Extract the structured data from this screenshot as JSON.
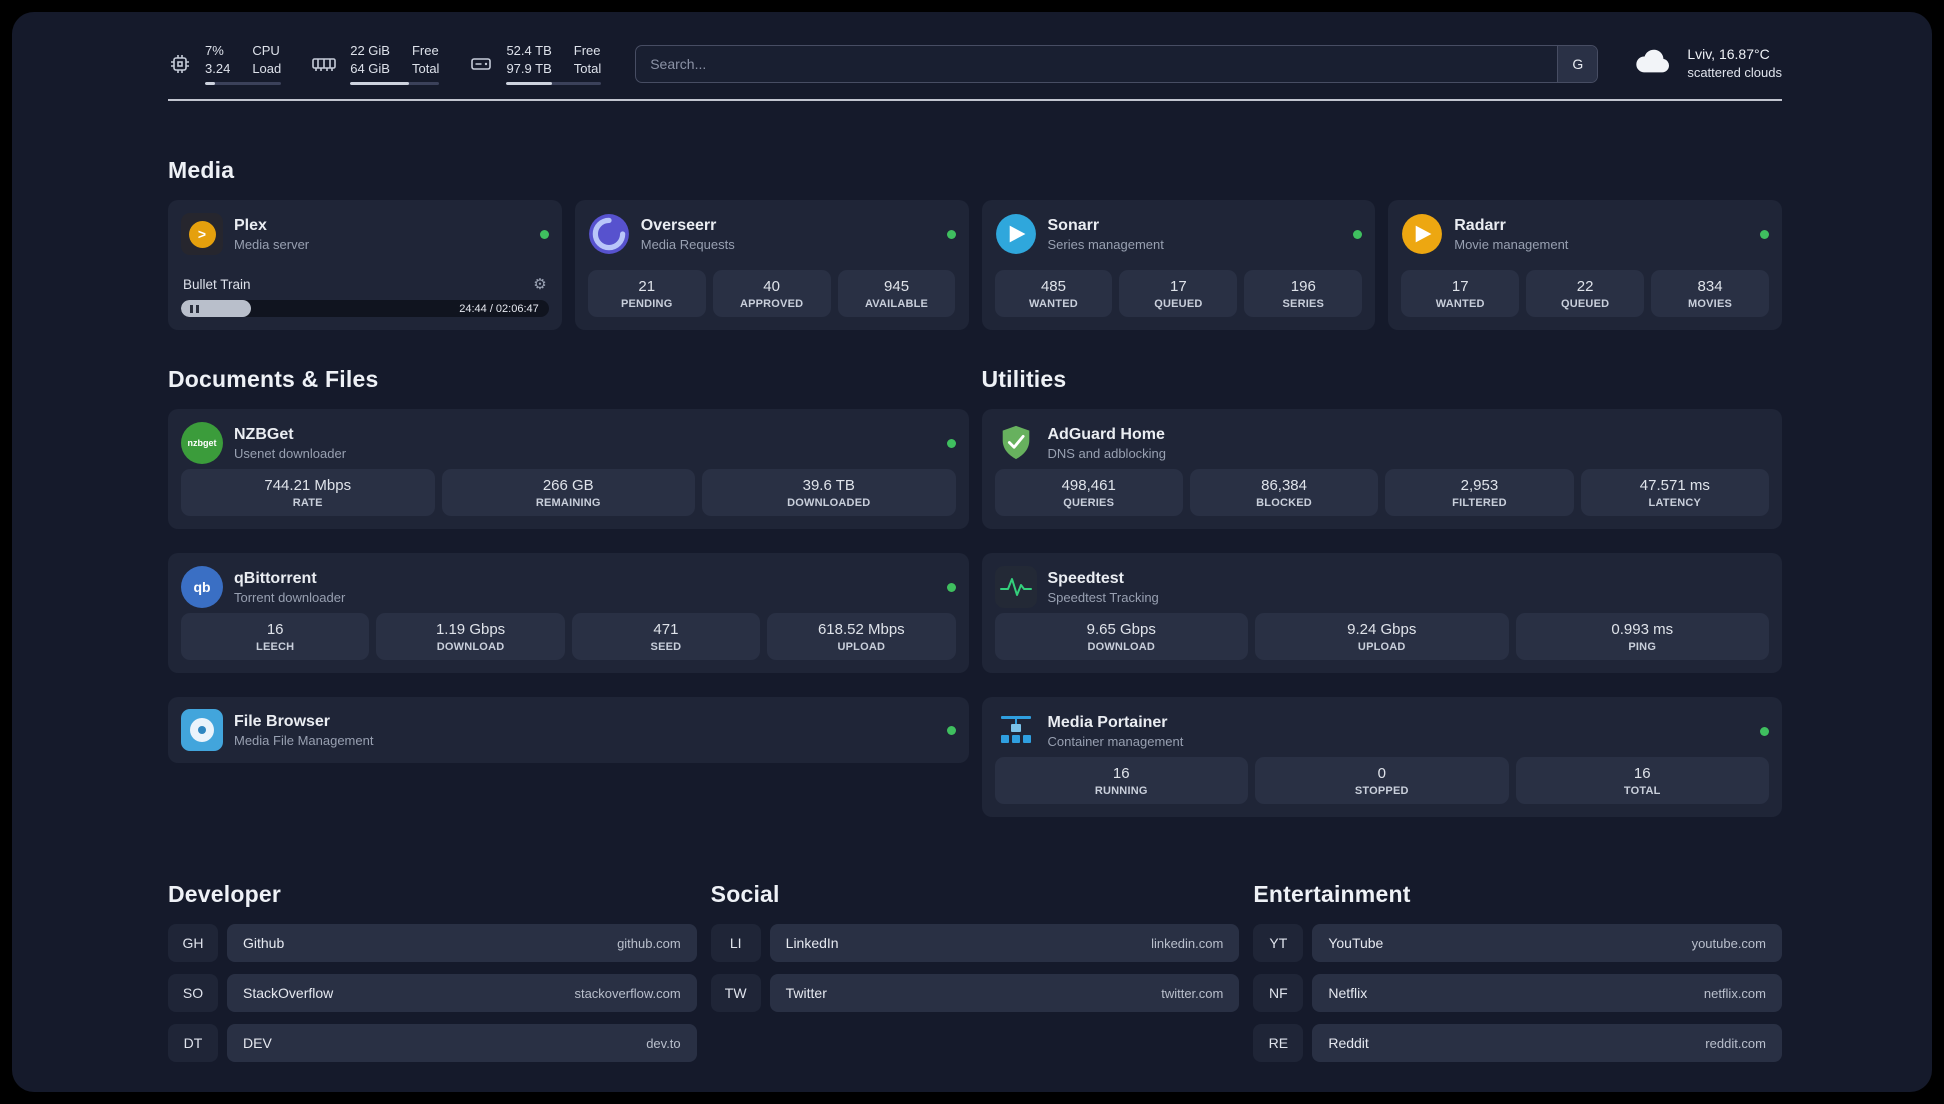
{
  "colors": {
    "page_background": "#151a2b",
    "card_background": "#1f2537",
    "tile_background": "#293044",
    "status_online": "#3fbf5f",
    "plex_accent": "#e5a00d",
    "overseerr_accent": "#5752ce",
    "sonarr_accent": "#2fa7dc",
    "radarr_accent": "#eda711",
    "nzbget_accent": "#3b9c3b",
    "qbittorrent_accent": "#3a6fc4",
    "filebrowser_accent": "#42a5dc",
    "adguard_accent": "#67b15e",
    "speedtest_accent": "#34d07c",
    "portainer_accent": "#2f9fe0"
  },
  "topbar": {
    "metrics": [
      {
        "icon": "cpu-icon",
        "value_top": "7%",
        "value_bottom": "3.24",
        "label_top": "CPU",
        "label_bottom": "Load",
        "progress": 13
      },
      {
        "icon": "memory-icon",
        "value_top": "22 GiB",
        "value_bottom": "64 GiB",
        "label_top": "Free",
        "label_bottom": "Total",
        "progress": 66
      },
      {
        "icon": "disk-icon",
        "value_top": "52.4 TB",
        "value_bottom": "97.9 TB",
        "label_top": "Free",
        "label_bottom": "Total",
        "progress": 48
      }
    ],
    "search": {
      "placeholder": "Search...",
      "engine_label": "G"
    },
    "weather": {
      "icon": "cloud-icon",
      "location": "Lviv, 16.87°C",
      "condition": "scattered clouds"
    }
  },
  "sections": {
    "media": {
      "title": "Media",
      "cards": [
        {
          "icon": "plex-icon",
          "name": "Plex",
          "subtitle": "Media server",
          "online": true,
          "player": {
            "title": "Bullet Train",
            "time": "24:44 / 02:06:47",
            "progress": 19,
            "state": "paused"
          }
        },
        {
          "icon": "overseerr-icon",
          "name": "Overseerr",
          "subtitle": "Media Requests",
          "online": true,
          "stats": [
            {
              "value": "21",
              "label": "PENDING"
            },
            {
              "value": "40",
              "label": "APPROVED"
            },
            {
              "value": "945",
              "label": "AVAILABLE"
            }
          ]
        },
        {
          "icon": "sonarr-icon",
          "name": "Sonarr",
          "subtitle": "Series management",
          "online": true,
          "stats": [
            {
              "value": "485",
              "label": "WANTED"
            },
            {
              "value": "17",
              "label": "QUEUED"
            },
            {
              "value": "196",
              "label": "SERIES"
            }
          ]
        },
        {
          "icon": "radarr-icon",
          "name": "Radarr",
          "subtitle": "Movie management",
          "online": true,
          "stats": [
            {
              "value": "17",
              "label": "WANTED"
            },
            {
              "value": "22",
              "label": "QUEUED"
            },
            {
              "value": "834",
              "label": "MOVIES"
            }
          ]
        }
      ]
    },
    "documents": {
      "title": "Documents & Files",
      "cards": [
        {
          "icon": "nzbget-icon",
          "name": "NZBGet",
          "subtitle": "Usenet downloader",
          "online": true,
          "stats": [
            {
              "value": "744.21 Mbps",
              "label": "RATE"
            },
            {
              "value": "266 GB",
              "label": "REMAINING"
            },
            {
              "value": "39.6 TB",
              "label": "DOWNLOADED"
            }
          ]
        },
        {
          "icon": "qbittorrent-icon",
          "name": "qBittorrent",
          "subtitle": "Torrent downloader",
          "online": true,
          "stats": [
            {
              "value": "16",
              "label": "LEECH"
            },
            {
              "value": "1.19 Gbps",
              "label": "DOWNLOAD"
            },
            {
              "value": "471",
              "label": "SEED"
            },
            {
              "value": "618.52 Mbps",
              "label": "UPLOAD"
            }
          ]
        },
        {
          "icon": "filebrowser-icon",
          "name": "File Browser",
          "subtitle": "Media File Management",
          "online": true,
          "stats": []
        }
      ]
    },
    "utilities": {
      "title": "Utilities",
      "cards": [
        {
          "icon": "adguard-icon",
          "name": "AdGuard Home",
          "subtitle": "DNS and adblocking",
          "stats": [
            {
              "value": "498,461",
              "label": "QUERIES"
            },
            {
              "value": "86,384",
              "label": "BLOCKED"
            },
            {
              "value": "2,953",
              "label": "FILTERED"
            },
            {
              "value": "47.571 ms",
              "label": "LATENCY"
            }
          ]
        },
        {
          "icon": "speedtest-icon",
          "name": "Speedtest",
          "subtitle": "Speedtest Tracking",
          "stats": [
            {
              "value": "9.65 Gbps",
              "label": "DOWNLOAD"
            },
            {
              "value": "9.24 Gbps",
              "label": "UPLOAD"
            },
            {
              "value": "0.993 ms",
              "label": "PING"
            }
          ]
        },
        {
          "icon": "portainer-icon",
          "name": "Media Portainer",
          "subtitle": "Container management",
          "online": true,
          "stats": [
            {
              "value": "16",
              "label": "RUNNING"
            },
            {
              "value": "0",
              "label": "STOPPED"
            },
            {
              "value": "16",
              "label": "TOTAL"
            }
          ]
        }
      ]
    }
  },
  "bookmarks": [
    {
      "title": "Developer",
      "links": [
        {
          "abbr": "GH",
          "name": "Github",
          "url": "github.com"
        },
        {
          "abbr": "SO",
          "name": "StackOverflow",
          "url": "stackoverflow.com"
        },
        {
          "abbr": "DT",
          "name": "DEV",
          "url": "dev.to"
        }
      ]
    },
    {
      "title": "Social",
      "links": [
        {
          "abbr": "LI",
          "name": "LinkedIn",
          "url": "linkedin.com"
        },
        {
          "abbr": "TW",
          "name": "Twitter",
          "url": "twitter.com"
        }
      ]
    },
    {
      "title": "Entertainment",
      "links": [
        {
          "abbr": "YT",
          "name": "YouTube",
          "url": "youtube.com"
        },
        {
          "abbr": "NF",
          "name": "Netflix",
          "url": "netflix.com"
        },
        {
          "abbr": "RE",
          "name": "Reddit",
          "url": "reddit.com"
        }
      ]
    }
  ]
}
